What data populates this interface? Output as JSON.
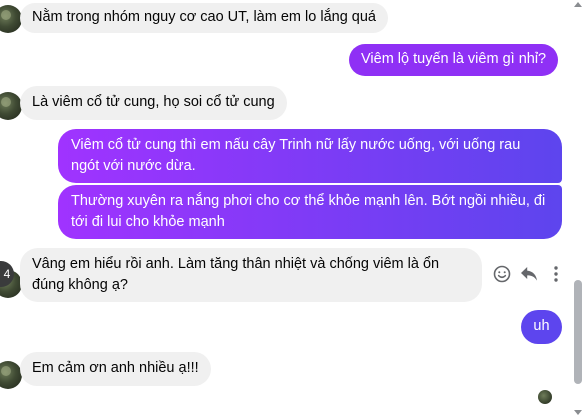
{
  "messages": [
    {
      "direction": "incoming",
      "text": "Nằm trong nhóm nguy cơ cao UT, làm em lo lắng quá"
    },
    {
      "direction": "outgoing",
      "text": "Viêm lộ tuyến là viêm gì nhỉ?"
    },
    {
      "direction": "incoming",
      "text": "Là viêm cổ tử cung, họ soi cổ tử cung"
    },
    {
      "direction": "outgoing",
      "text": "Viêm cổ tử cung thì em nấu cây Trinh nữ lấy nước uống, với uống rau ngót với nước dừa."
    },
    {
      "direction": "outgoing",
      "text": "Thường xuyên ra nắng phơi cho cơ thể khỏe mạnh lên. Bớt ngồi nhiều, đi tới đi lui cho khỏe mạnh"
    },
    {
      "direction": "incoming",
      "text": "Vâng em hiểu rồi anh. Làm tăng thân nhiệt và chống viêm là ổn đúng không ạ?"
    },
    {
      "direction": "outgoing",
      "text": "uh"
    },
    {
      "direction": "incoming",
      "text": "Em cảm ơn anh nhiều ạ!!!"
    }
  ],
  "unread_badge": "4",
  "hover_actions": [
    "emoji-icon",
    "reply-icon",
    "more-options-icon"
  ],
  "colors": {
    "outgoing_start": "#a033ff",
    "outgoing_end": "#5d45ee",
    "incoming_bg": "#f0f0f0"
  }
}
